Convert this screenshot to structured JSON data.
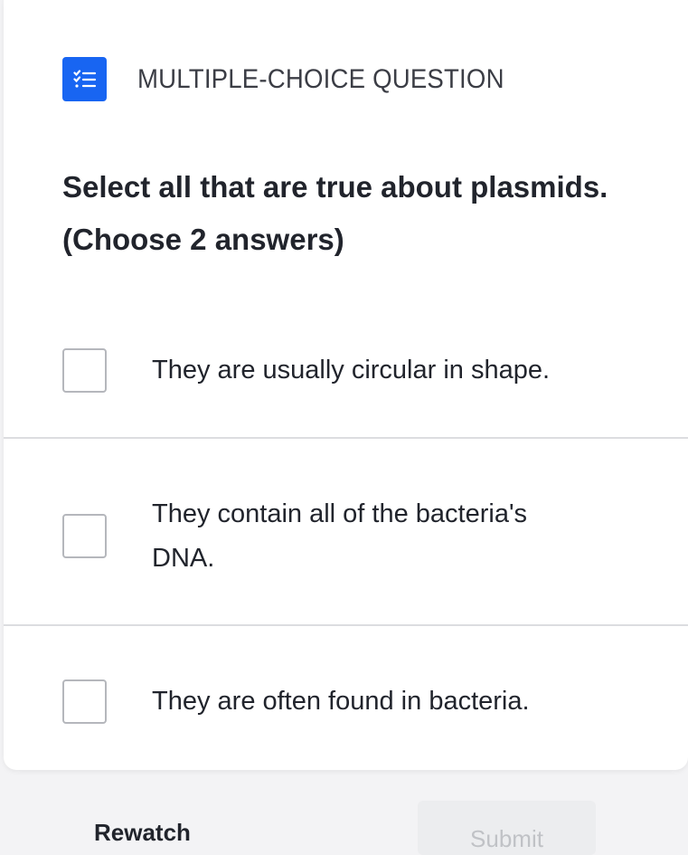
{
  "question": {
    "type_label": "MULTIPLE-CHOICE QUESTION",
    "type_icon": "checklist-icon",
    "prompt_line1": "Select all that are true about plasmids.",
    "prompt_line2": "(Choose 2 answers)",
    "choices": [
      {
        "label": "They are usually circular in shape.",
        "checked": false
      },
      {
        "label": "They contain all of the bacteria's DNA.",
        "checked": false
      },
      {
        "label": "They are often found in bacteria.",
        "checked": false
      }
    ]
  },
  "actions": {
    "rewatch_label": "Rewatch",
    "submit_label": "Submit",
    "submit_enabled": false
  },
  "colors": {
    "accent": "#1865f2",
    "text": "#21242c",
    "divider": "#dcdde0",
    "disabled": "#ecedef"
  }
}
